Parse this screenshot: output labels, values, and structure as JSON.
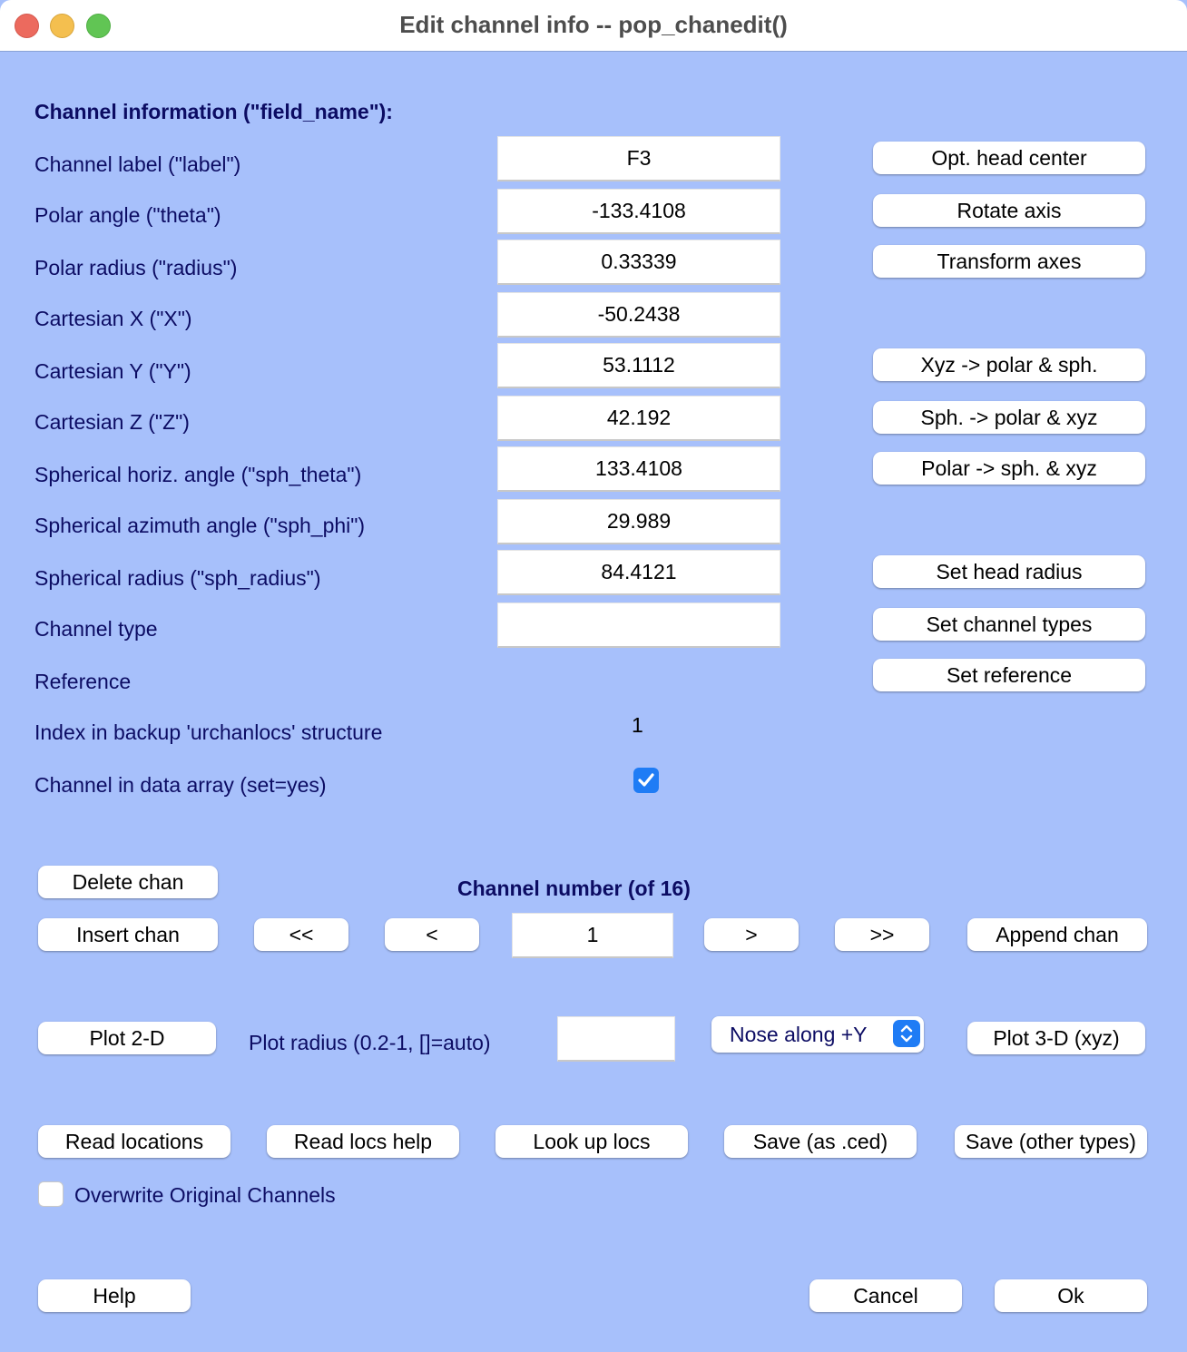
{
  "window": {
    "title": "Edit channel info -- pop_chanedit()",
    "controls": [
      "close",
      "minimize",
      "maximize"
    ]
  },
  "section_header": "Channel information (\"field_name\"):",
  "fields": [
    {
      "label": "Channel label (\"label\")",
      "value": "F3"
    },
    {
      "label": "Polar angle (\"theta\")",
      "value": "-133.4108"
    },
    {
      "label": "Polar radius (\"radius\")",
      "value": "0.33339"
    },
    {
      "label": "Cartesian X (\"X\")",
      "value": "-50.2438"
    },
    {
      "label": "Cartesian Y (\"Y\")",
      "value": "53.1112"
    },
    {
      "label": "Cartesian Z (\"Z\")",
      "value": "42.192"
    },
    {
      "label": "Spherical horiz. angle (\"sph_theta\")",
      "value": "133.4108"
    },
    {
      "label": "Spherical azimuth angle (\"sph_phi\")",
      "value": "29.989"
    },
    {
      "label": "Spherical radius (\"sph_radius\")",
      "value": "84.4121"
    },
    {
      "label": "Channel type",
      "value": ""
    }
  ],
  "reference_label": "Reference",
  "index_label": "Index in backup 'urchanlocs' structure",
  "index_value": "1",
  "in_data_label": "Channel in data array (set=yes)",
  "in_data_checked": true,
  "side_buttons": {
    "opt_head_center": "Opt. head center",
    "rotate_axis": "Rotate axis",
    "transform_axes": "Transform axes",
    "xyz_to_polar": "Xyz -> polar & sph.",
    "sph_to_polar": "Sph. -> polar & xyz",
    "polar_to_sph": "Polar -> sph. & xyz",
    "set_head_radius": "Set head radius",
    "set_channel_types": "Set channel types",
    "set_reference": "Set reference"
  },
  "navigation": {
    "delete_chan": "Delete chan",
    "insert_chan": "Insert chan",
    "channel_number_label": "Channel number (of 16)",
    "first": "<<",
    "prev": "<",
    "channel_number": "1",
    "next": ">",
    "last": ">>",
    "append_chan": "Append chan"
  },
  "plot": {
    "plot_2d": "Plot 2-D",
    "radius_label": "Plot radius (0.2-1, []=auto)",
    "radius_value": "",
    "nose_select": "Nose along +Y",
    "plot_3d": "Plot 3-D (xyz)"
  },
  "file": {
    "read_locations": "Read locations",
    "read_locs_help": "Read locs help",
    "look_up_locs": "Look up locs",
    "save_ced": "Save (as .ced)",
    "save_other": "Save (other types)",
    "overwrite_label": "Overwrite Original Channels",
    "overwrite_checked": false
  },
  "footer": {
    "help": "Help",
    "cancel": "Cancel",
    "ok": "Ok"
  }
}
